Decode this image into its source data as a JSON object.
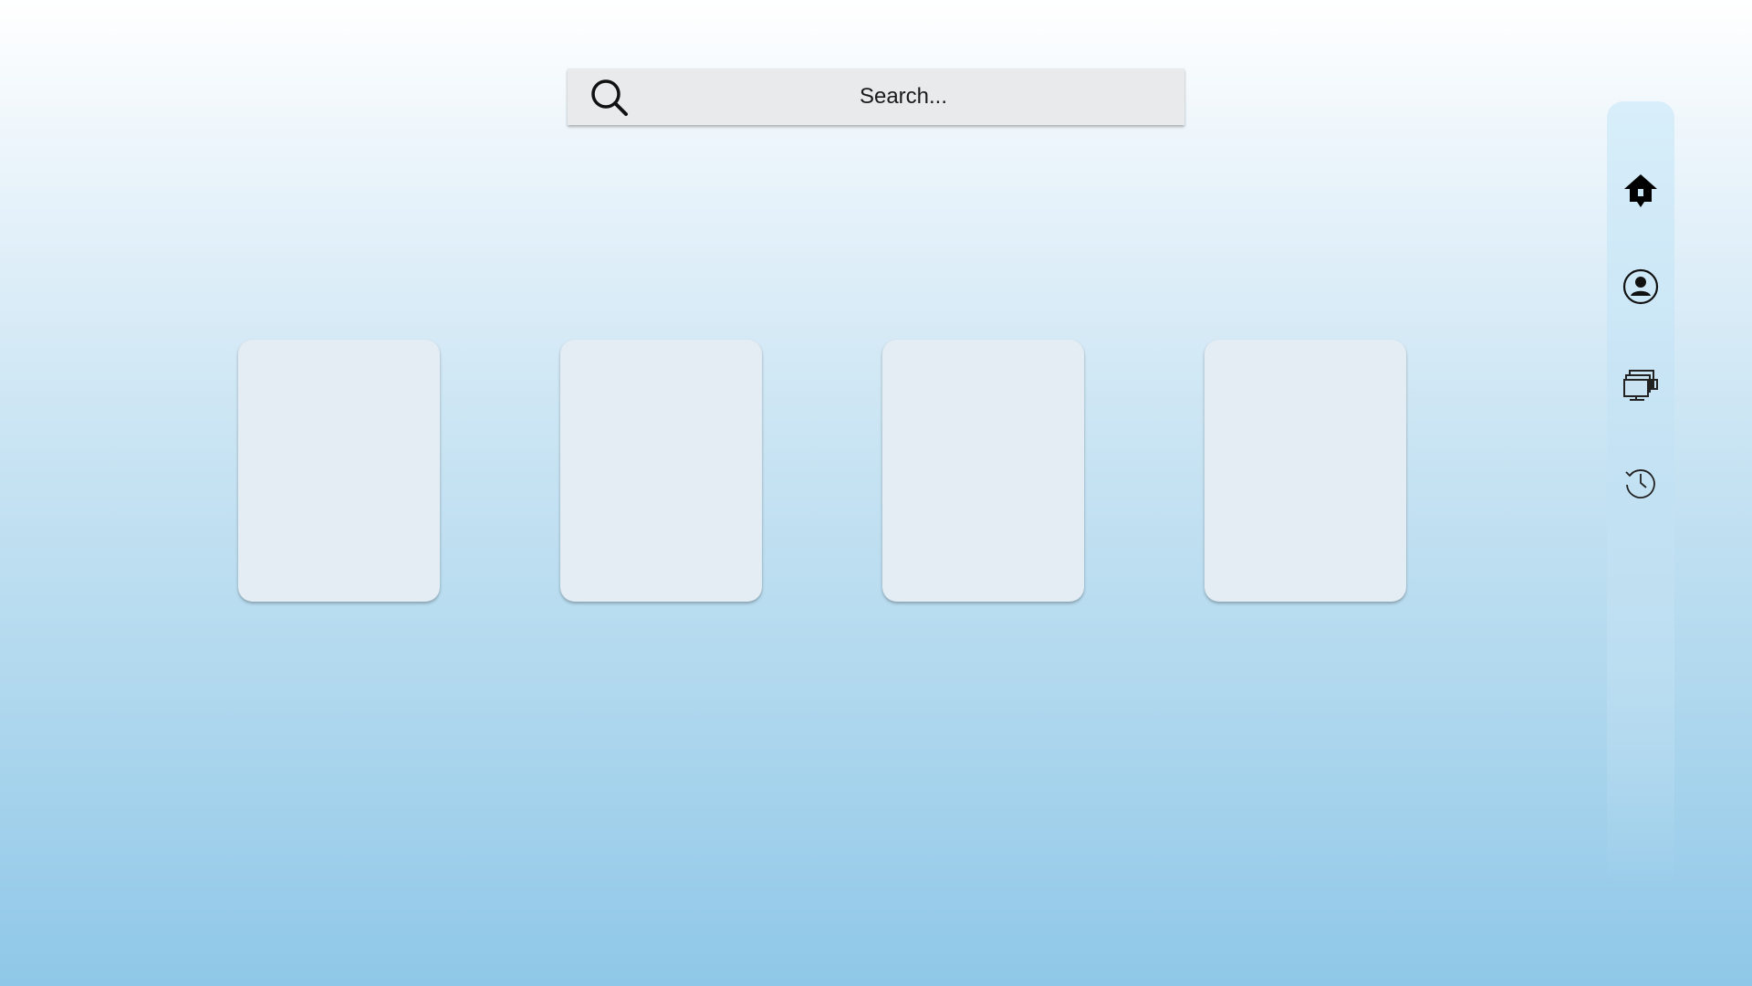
{
  "search": {
    "placeholder": "Search...",
    "icon": "search-icon"
  },
  "cards": [
    {
      "name": "card-1"
    },
    {
      "name": "card-2"
    },
    {
      "name": "card-3"
    },
    {
      "name": "card-4"
    }
  ],
  "sidebar": {
    "items": [
      {
        "icon": "home-icon",
        "active": true
      },
      {
        "icon": "profile-icon",
        "active": false
      },
      {
        "icon": "windows-icon",
        "active": false
      },
      {
        "icon": "history-icon",
        "active": false
      }
    ]
  },
  "colors": {
    "background_top": "#ffffff",
    "background_bottom": "#8fc7e8",
    "search_bg": "#e8eaec",
    "card_bg": "#e4ecf4",
    "sidebar_bg": "#d8eefa"
  }
}
